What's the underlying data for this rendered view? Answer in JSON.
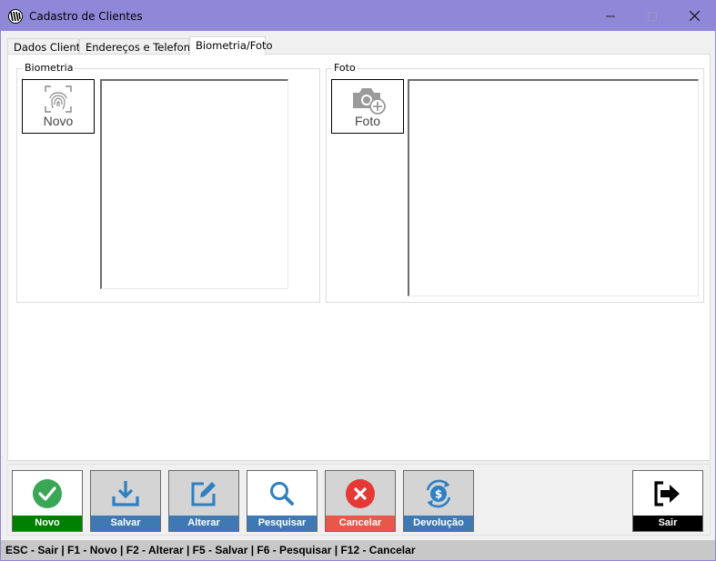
{
  "window": {
    "title": "Cadastro de Clientes"
  },
  "tabs": [
    {
      "label": "Dados Cliente"
    },
    {
      "label": "Endereços e Telefones"
    },
    {
      "label": "Biometria/Foto"
    }
  ],
  "biometria": {
    "group_label": "Biometria",
    "button_label": "Novo",
    "icon": "fingerprint-icon"
  },
  "foto": {
    "group_label": "Foto",
    "button_label": "Foto",
    "icon": "camera-add-icon"
  },
  "toolbar": {
    "novo": {
      "label": "Novo",
      "color": "#008000",
      "icon": "check-circle-icon"
    },
    "salvar": {
      "label": "Salvar",
      "color": "#3f79b4",
      "icon": "download-icon"
    },
    "alterar": {
      "label": "Alterar",
      "color": "#3f79b4",
      "icon": "edit-icon"
    },
    "pesquisar": {
      "label": "Pesquisar",
      "color": "#3f79b4",
      "icon": "search-icon"
    },
    "cancelar": {
      "label": "Cancelar",
      "color": "#e8574a",
      "icon": "close-circle-icon"
    },
    "devolucao": {
      "label": "Devolução",
      "color": "#3f79b4",
      "icon": "dollar-refresh-icon"
    },
    "sair": {
      "label": "Sair",
      "color": "#000000",
      "icon": "exit-icon"
    }
  },
  "statusbar": {
    "text": "ESC - Sair  |  F1 - Novo  |  F2 - Alterar  |  F5 - Salvar  |  F6 - Pesquisar  |  F12 - Cancelar"
  }
}
